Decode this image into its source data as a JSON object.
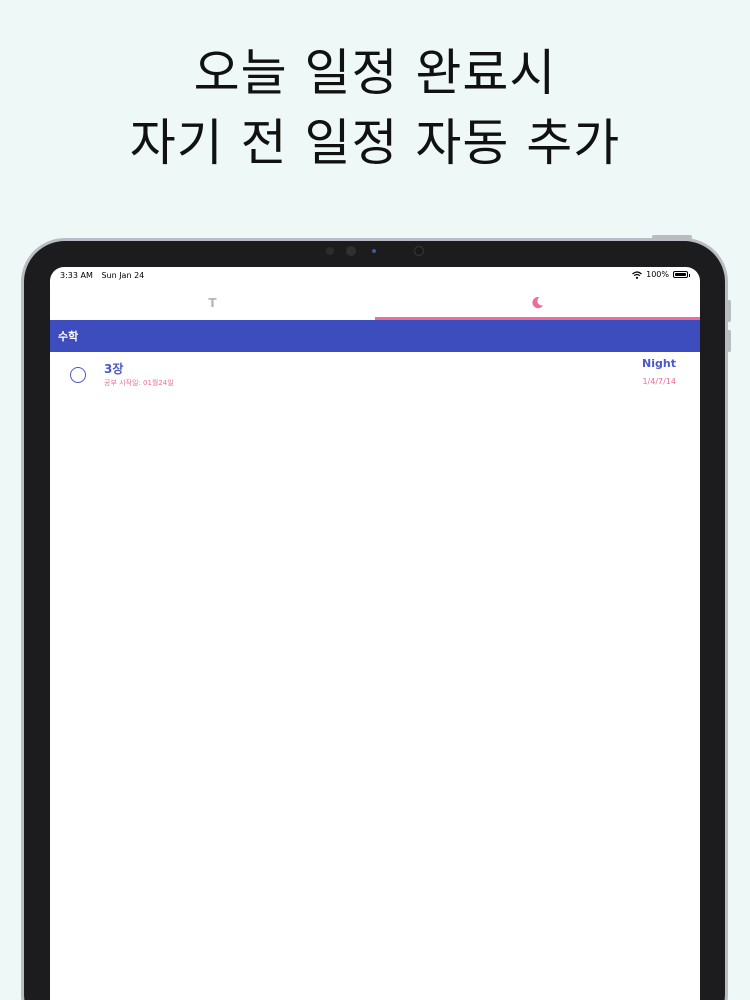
{
  "headline": {
    "line1": "오늘 일정 완료시",
    "line2": "자기 전 일정 자동 추가"
  },
  "status_bar": {
    "time": "3:33 AM",
    "date": "Sun Jan 24",
    "battery": "100%",
    "wifi_icon": "wifi-icon",
    "battery_icon": "battery-icon"
  },
  "tabs": [
    {
      "label": "T",
      "icon": "today-icon",
      "selected": false
    },
    {
      "label": "",
      "icon": "moon-icon",
      "selected": true
    }
  ],
  "colors": {
    "accent_blue": "#3d4dbd",
    "accent_pink": "#ef6b9a",
    "background": "#eef8f7"
  },
  "section": {
    "title": "수학"
  },
  "tasks": [
    {
      "title": "3장",
      "subtitle": "공부 시작일: 01월24일",
      "time_label": "Night",
      "cycle": "1/4/7/14",
      "done": false
    }
  ]
}
